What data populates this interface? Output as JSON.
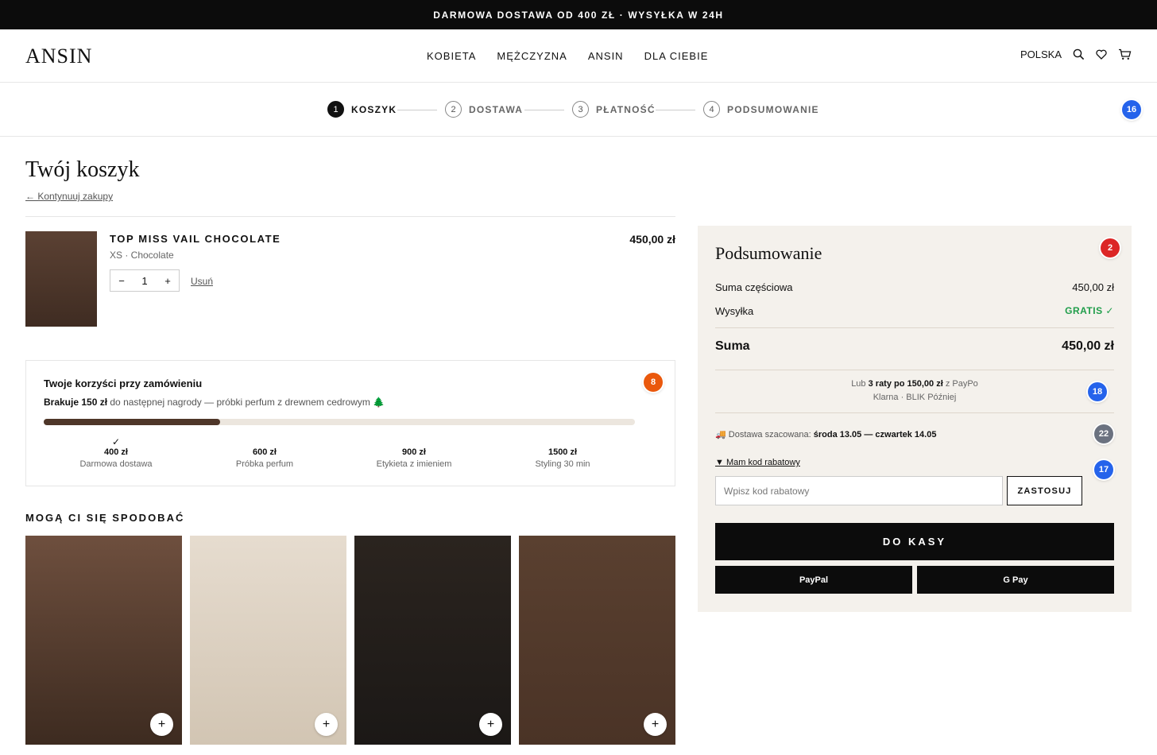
{
  "topbar": {
    "text": "DARMOWA DOSTAWA OD 400 ZŁ · WYSYŁKA W 24H"
  },
  "header": {
    "logo": "ANSIN",
    "nav": [
      "KOBIETA",
      "MĘŻCZYZNA",
      "ANSIN",
      "DLA CIEBIE"
    ],
    "country": "POLSKA",
    "icons": [
      "search-icon",
      "heart-icon",
      "cart-icon"
    ]
  },
  "steps": [
    {
      "num": "1",
      "label": "KOSZYK",
      "active": true
    },
    {
      "num": "2",
      "label": "DOSTAWA",
      "active": false
    },
    {
      "num": "3",
      "label": "PŁATNOŚĆ",
      "active": false
    },
    {
      "num": "4",
      "label": "PODSUMOWANIE",
      "active": false
    }
  ],
  "badges": {
    "steps": {
      "text": "16",
      "color": "#2563eb"
    },
    "summary": {
      "text": "2",
      "color": "#dc2626"
    },
    "benefits": {
      "text": "8",
      "color": "#ea580c"
    },
    "installments": {
      "text": "18",
      "color": "#2563eb"
    },
    "delivery": {
      "text": "22",
      "color": "#6b7280"
    },
    "discount": {
      "text": "17",
      "color": "#2563eb"
    }
  },
  "cart": {
    "title": "Twój koszyk",
    "continue": "← Kontynuuj zakupy",
    "item": {
      "name": "TOP MISS VAIL CHOCOLATE",
      "variant": "XS · Chocolate",
      "price": "450,00 zł",
      "qty": "1",
      "minus": "−",
      "plus": "+",
      "remove": "Usuń"
    }
  },
  "benefits": {
    "title": "Twoje korzyści przy zamówieniu",
    "missing": "Brakuje 150 zł",
    "rest": " do następnej nagrody — próbki perfum z drewnem cedrowym 🌲",
    "progress": 0.298,
    "tiers": [
      {
        "check": "✓",
        "amount": "400 zł",
        "label": "Darmowa dostawa"
      },
      {
        "check": "",
        "amount": "600 zł",
        "label": "Próbka perfum"
      },
      {
        "check": "",
        "amount": "900 zł",
        "label": "Etykieta z imieniem"
      },
      {
        "check": "",
        "amount": "1500 zł",
        "label": "Styling 30 min"
      }
    ]
  },
  "recommendations": {
    "title": "MOGĄ CI SIĘ SPODOBAĆ",
    "add_label": "+",
    "colors": [
      [
        "#6e4f3e",
        "#3d2b20"
      ],
      [
        "#e6dccf",
        "#d2c5b3"
      ],
      [
        "#2b241f",
        "#1b1816"
      ],
      [
        "#5a4030",
        "#4a3326"
      ]
    ]
  },
  "summary": {
    "title": "Podsumowanie",
    "subtotal_label": "Suma częściowa",
    "subtotal_value": "450,00 zł",
    "shipping_label": "Wysyłka",
    "shipping_value": "GRATIS ✓",
    "total_label": "Suma",
    "total_value": "450,00 zł",
    "inst_prefix": "Lub ",
    "inst_bold": "3 raty po 150,00 zł",
    "inst_suffix": " z PayPo",
    "inst_line2": "Klarna · BLIK Później",
    "delivery_prefix": "🚚 Dostawa szacowana: ",
    "delivery_bold": "środa 13.05 — czwartek 14.05",
    "discount_toggle": "▼ Mam kod rabatowy",
    "discount_placeholder": "Wpisz kod rabatowy",
    "apply": "ZASTOSUJ",
    "checkout": "DO KASY",
    "paypal": "PayPal",
    "gpay": "G Pay"
  }
}
